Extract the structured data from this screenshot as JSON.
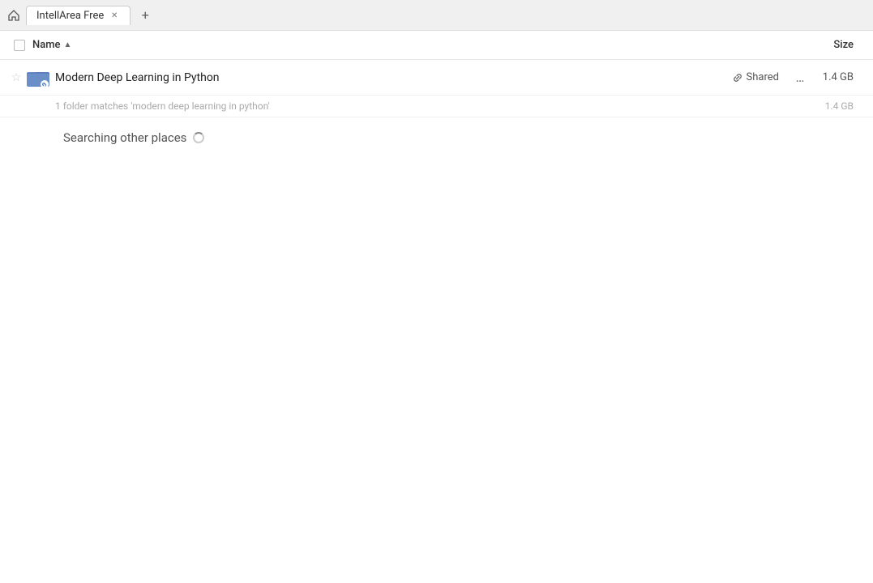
{
  "titlebar": {
    "home_icon": "⌂",
    "separator": "›",
    "tab_label": "IntellArea Free",
    "new_tab_icon": "+"
  },
  "columns": {
    "name_label": "Name",
    "sort_icon": "▲",
    "size_label": "Size"
  },
  "file_row": {
    "folder_name": "Modern Deep Learning in Python",
    "shared_label": "Shared",
    "more_icon": "…",
    "size": "1.4 GB"
  },
  "match_info": {
    "text": "1 folder matches 'modern deep learning in python'",
    "size": "1.4 GB"
  },
  "searching": {
    "label": "Searching other places"
  }
}
